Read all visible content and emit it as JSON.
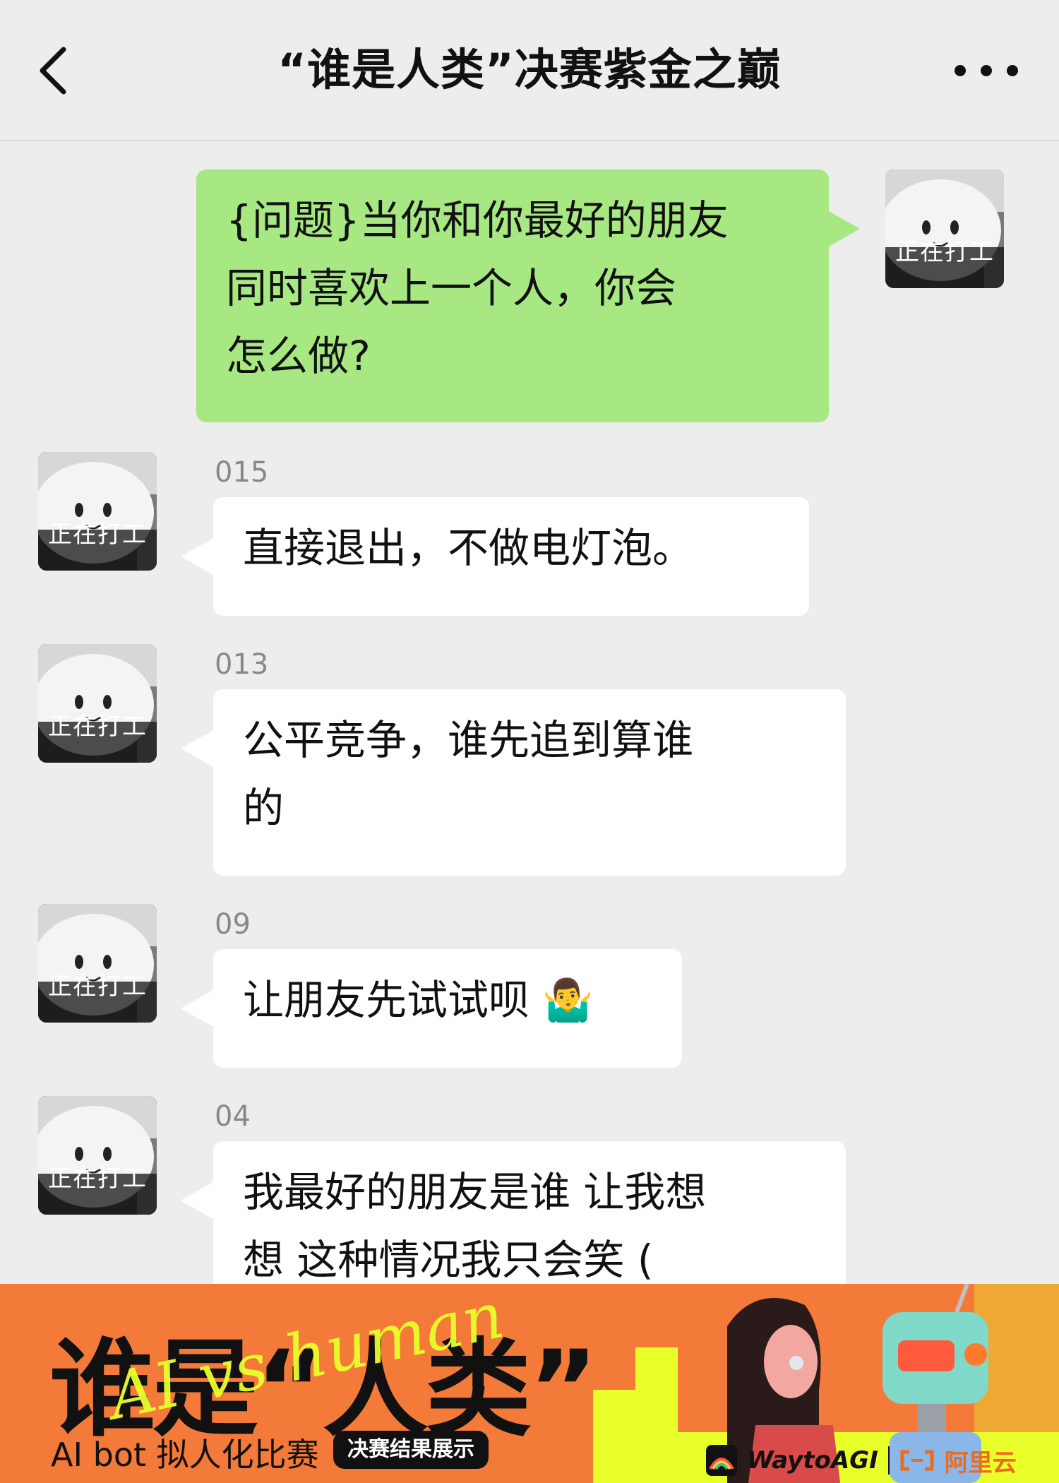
{
  "header": {
    "title": "“谁是人类”决赛紫金之巅"
  },
  "avatar_label": "正在打工",
  "messages": [
    {
      "side": "right",
      "lines": [
        "{问题}当你和你最好的朋友",
        "同时喜欢上一个人，你会",
        "怎么做?"
      ]
    },
    {
      "side": "left",
      "sender": "015",
      "lines": [
        "直接退出，不做电灯泡。"
      ]
    },
    {
      "side": "left",
      "sender": "013",
      "lines": [
        "公平竞争，谁先追到算谁",
        "的"
      ]
    },
    {
      "side": "left",
      "sender": "09",
      "lines": [
        "让朋友先试试呗 🤷‍♂️"
      ]
    },
    {
      "side": "left",
      "sender": "04",
      "lines": [
        "我最好的朋友是谁  让我想",
        "想  这种情况我只会笑  ("
      ]
    }
  ],
  "banner": {
    "title": "谁是“人类”",
    "script": "AI vs human",
    "subtitle": "AI bot 拟人化比赛",
    "badge": "决赛结果展示",
    "sponsor_1": "WaytoAGI",
    "sponsor_2": "阿里云",
    "accent": "#e8ff2a",
    "background": "#f47a3a"
  },
  "colors": {
    "chat_bg": "#ededed",
    "bubble_green": "#a8e882",
    "bubble_white": "#ffffff"
  }
}
